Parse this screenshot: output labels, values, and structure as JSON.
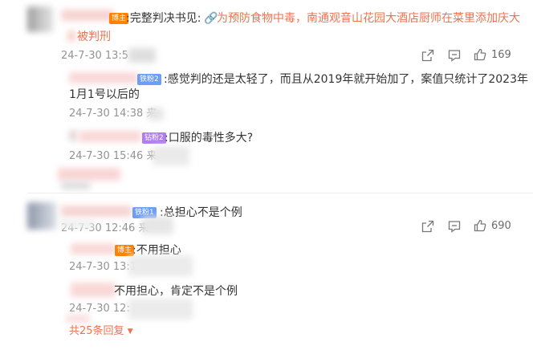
{
  "comment1": {
    "author_badge": "博主",
    "text_prefix": ":完整判决书见:",
    "link_text": "为预防食物中毒，南通观音山花园大酒店厨师在菜里添加庆大",
    "link_text_line2": "被判刑",
    "time": "24-7-30 13:5",
    "like_count": "169",
    "replies": [
      {
        "badge": "铁粉2",
        "text_line1": ":感觉判的还是太轻了，而且从2019年就开始加了，案值只统计了2023年",
        "text_line2": "1月1号以后的",
        "time": "24-7-30 14:38 来"
      },
      {
        "badge": "钻粉2",
        "text": ":口服的毒性多大?",
        "time": "24-7-30 15:46 来"
      }
    ]
  },
  "comment2": {
    "badge": "铁粉1",
    "text": ":总担心不是个例",
    "time": "24-7-30 12:46 来",
    "like_count": "690",
    "replies": [
      {
        "badge": "博主",
        "text": ":不用担心",
        "time": "24-7-30 13:1"
      },
      {
        "text": "不用担心，肯定不是个例",
        "time": "24-7-30 12:"
      }
    ],
    "more_replies": "共25条回复"
  },
  "icons": {
    "share": "share-icon",
    "comment": "comment-icon",
    "like": "thumbs-up-icon",
    "expand": "caret-down-icon"
  },
  "colors": {
    "link": "#eb7350",
    "author_badge": "#ff8200",
    "fan_badge": "#6d9df5",
    "diamond_badge": "#b07df0",
    "blur_pink": "#f9d7d7"
  }
}
